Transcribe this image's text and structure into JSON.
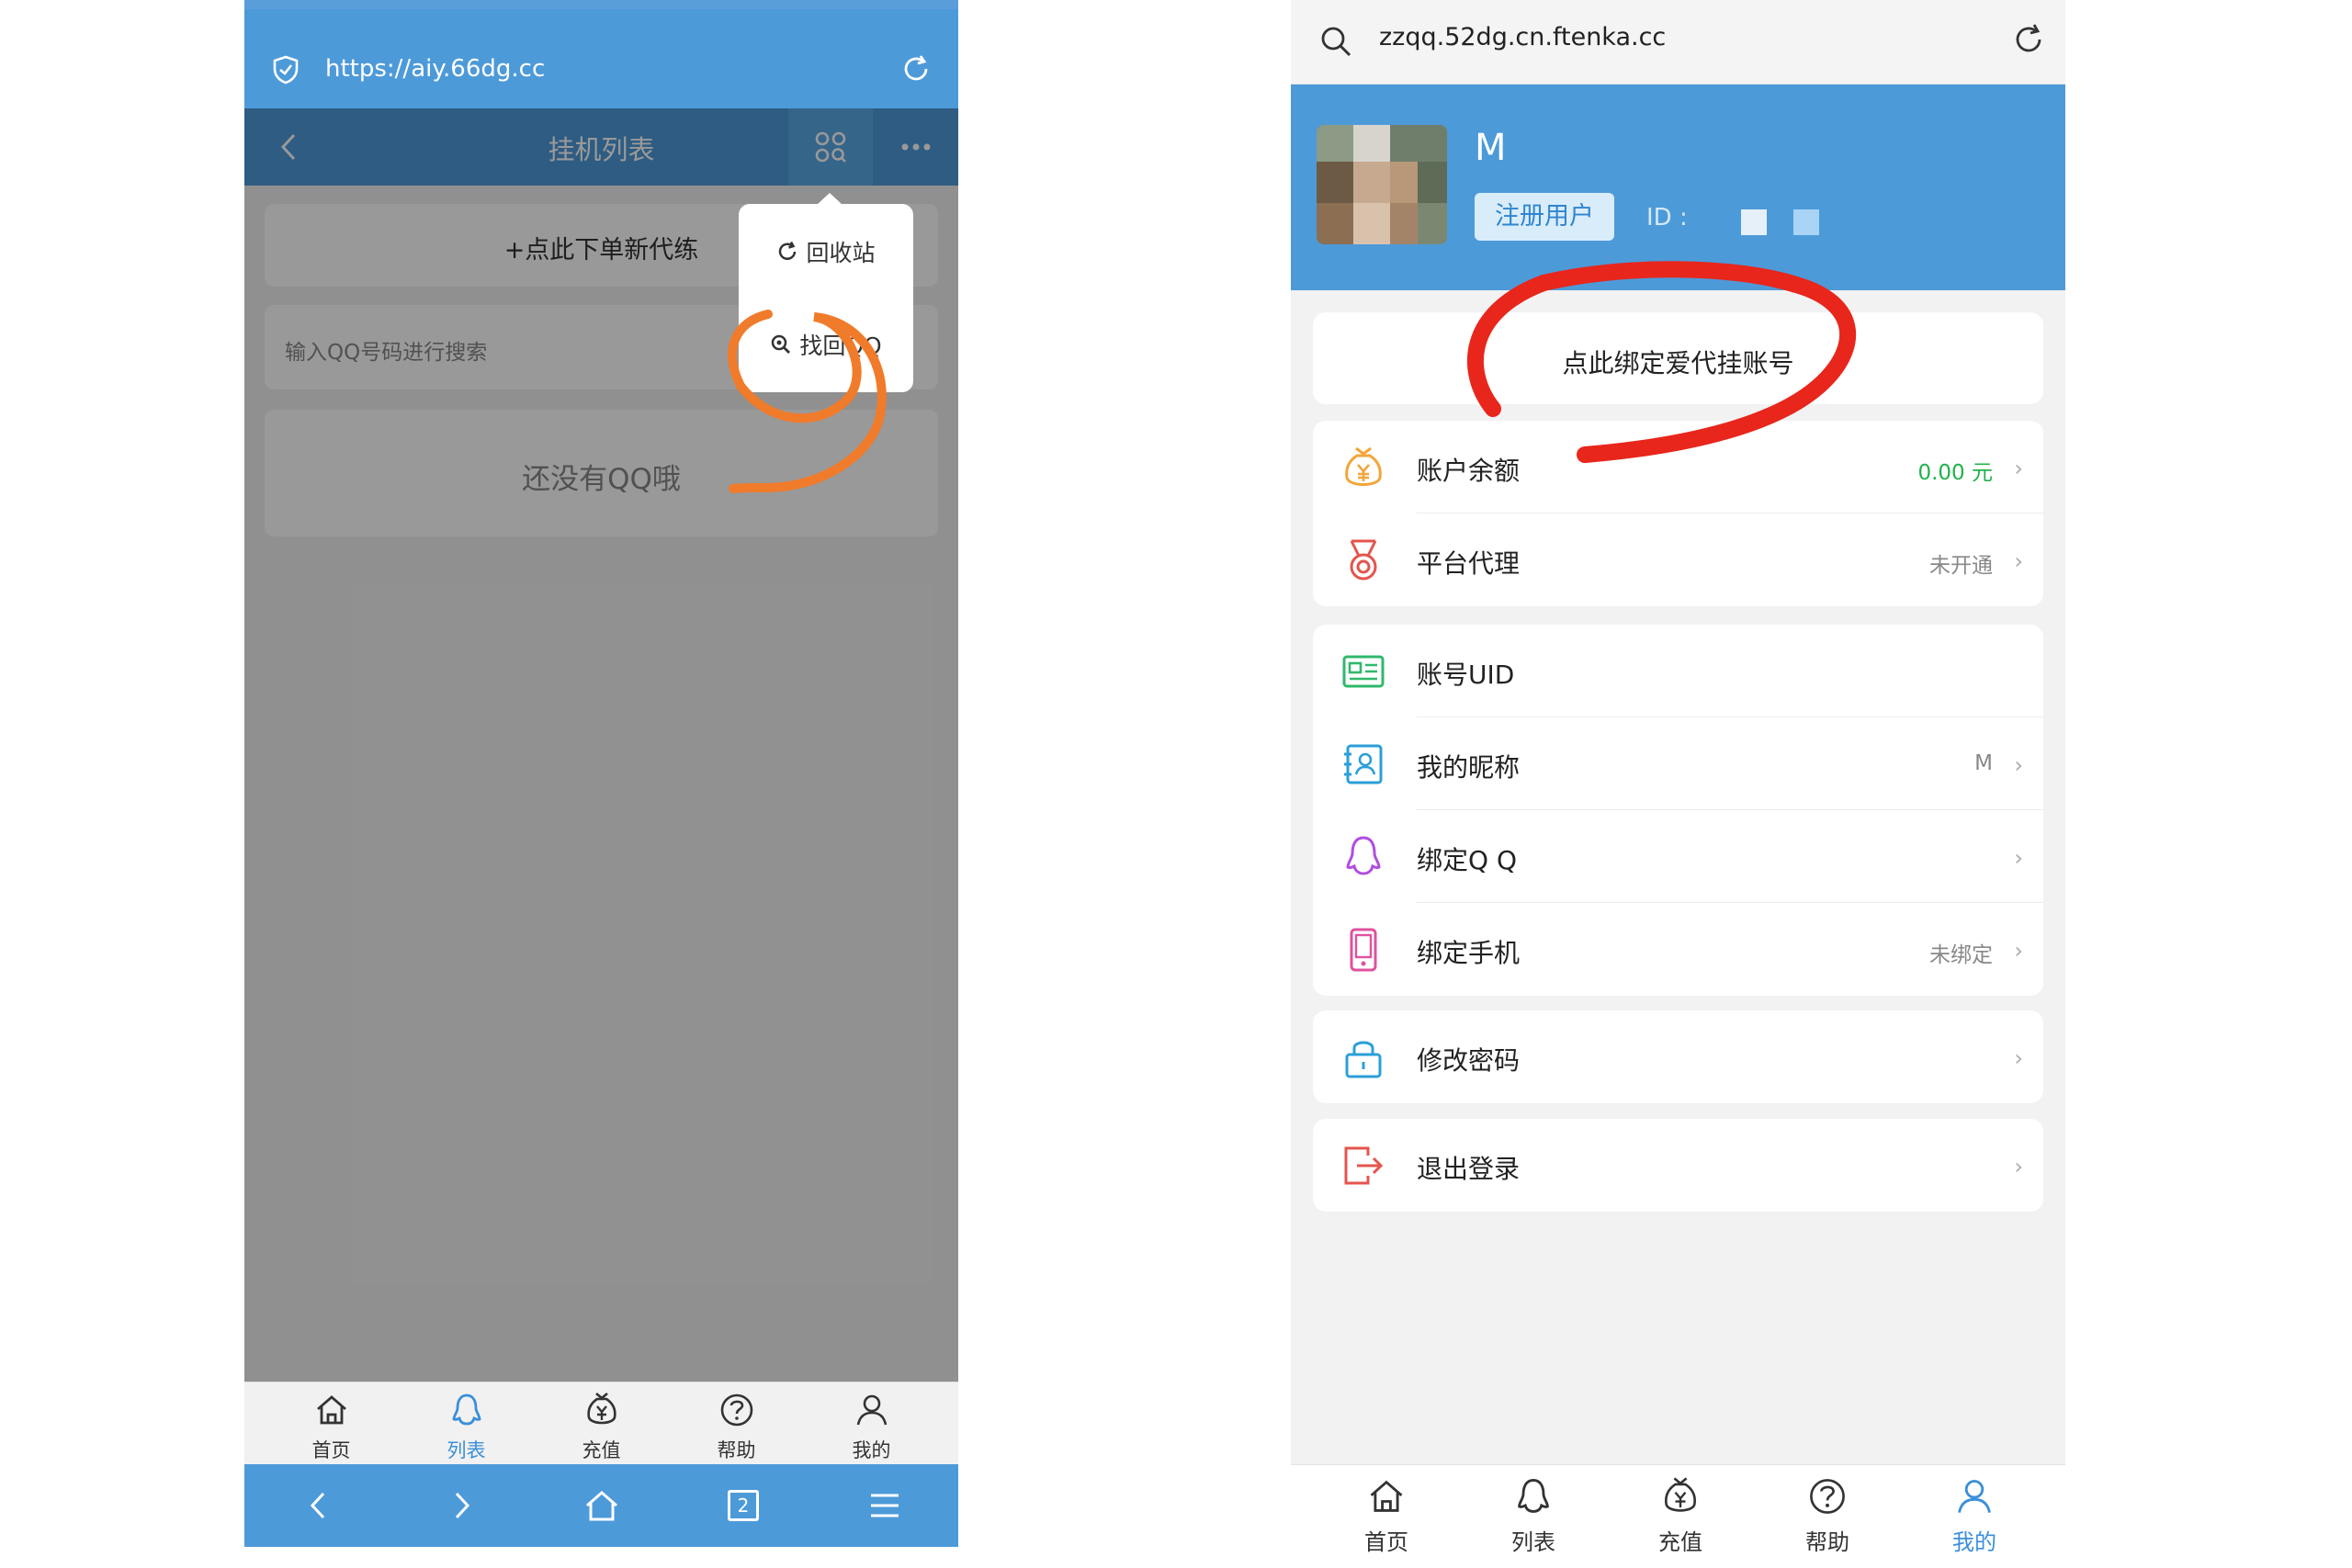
{
  "left_phone": {
    "url": "https://aiy.66dg.cc",
    "nav_title": "挂机列表",
    "new_order_label": "+点此下单新代练",
    "search_placeholder": "输入QQ号码进行搜索",
    "empty_text": "还没有QQ哦",
    "popup_menu": [
      {
        "label": "回收站",
        "icon": "refresh-icon"
      },
      {
        "label": "找回QQ",
        "icon": "search-icon"
      }
    ],
    "tabs": [
      {
        "label": "首页",
        "icon": "home-icon",
        "active": false
      },
      {
        "label": "列表",
        "icon": "penguin-icon",
        "active": true
      },
      {
        "label": "充值",
        "icon": "money-bag-icon",
        "active": false
      },
      {
        "label": "帮助",
        "icon": "help-icon",
        "active": false
      },
      {
        "label": "我的",
        "icon": "user-icon",
        "active": false
      }
    ],
    "browser_tab_count": "2"
  },
  "right_phone": {
    "url": "zzqq.52dg.cn.ftenka.cc",
    "user_name": "M",
    "user_badge": "注册用户",
    "id_label": "ID :",
    "bind_account_label": "点此绑定爱代挂账号",
    "menu": {
      "balance": {
        "label": "账户余额",
        "value": "0.00 元"
      },
      "agent": {
        "label": "平台代理",
        "value": "未开通"
      },
      "uid": {
        "label": "账号UID",
        "value": ""
      },
      "nickname": {
        "label": "我的昵称",
        "value": "M"
      },
      "bind_qq": {
        "label": "绑定Q Q",
        "value": ""
      },
      "bind_phone": {
        "label": "绑定手机",
        "value": "未绑定"
      },
      "change_password": {
        "label": "修改密码"
      },
      "logout": {
        "label": "退出登录"
      }
    },
    "tabs": [
      {
        "label": "首页",
        "icon": "home-icon",
        "active": false
      },
      {
        "label": "列表",
        "icon": "penguin-icon",
        "active": false
      },
      {
        "label": "充值",
        "icon": "money-bag-icon",
        "active": false
      },
      {
        "label": "帮助",
        "icon": "help-icon",
        "active": false
      },
      {
        "label": "我的",
        "icon": "user-icon",
        "active": true
      }
    ]
  },
  "colors": {
    "brand_blue": "#4d9ad9",
    "active_tab": "#3a8fd9",
    "balance_green": "#22b14c",
    "orange_annotation": "#f07b2a",
    "red_annotation": "#e8261b"
  }
}
